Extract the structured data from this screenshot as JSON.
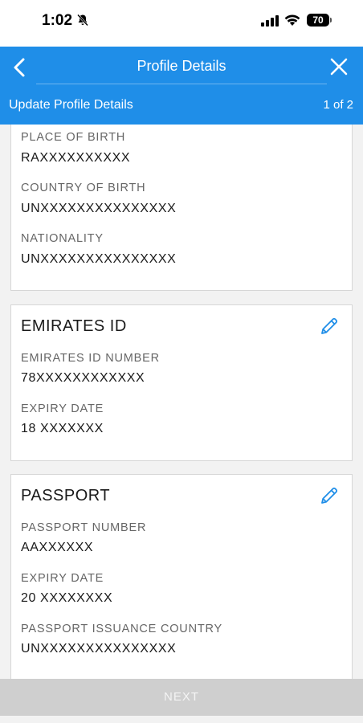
{
  "status_bar": {
    "time": "1:02",
    "battery": "70",
    "icons": [
      "bell-muted-icon",
      "signal-icon",
      "wifi-icon",
      "battery-icon"
    ]
  },
  "header": {
    "title": "Profile Details",
    "subtitle": "Update Profile Details",
    "step": "1 of 2",
    "back_icon": "chevron-left-icon",
    "close_icon": "close-icon",
    "accent_color": "#1f8ee8"
  },
  "personal": {
    "fields": [
      {
        "label": "PLACE OF BIRTH",
        "value": "RAXXXXXXXXXX"
      },
      {
        "label": "COUNTRY OF BIRTH",
        "value": "UNXXXXXXXXXXXXXXX"
      },
      {
        "label": "NATIONALITY",
        "value": "UNXXXXXXXXXXXXXXX"
      }
    ]
  },
  "emirates_id": {
    "title": "EMIRATES ID",
    "edit_icon": "pencil-icon",
    "fields": [
      {
        "label": "EMIRATES ID NUMBER",
        "value": "78XXXXXXXXXXXX"
      },
      {
        "label": "EXPIRY DATE",
        "value": "18 XXXXXXX"
      }
    ]
  },
  "passport": {
    "title": "PASSPORT",
    "edit_icon": "pencil-icon",
    "fields": [
      {
        "label": "PASSPORT NUMBER",
        "value": "AAXXXXXX"
      },
      {
        "label": "EXPIRY DATE",
        "value": "20 XXXXXXXX"
      },
      {
        "label": "PASSPORT ISSUANCE COUNTRY",
        "value": "UNXXXXXXXXXXXXXXX"
      }
    ]
  },
  "footer": {
    "next_label": "NEXT"
  }
}
